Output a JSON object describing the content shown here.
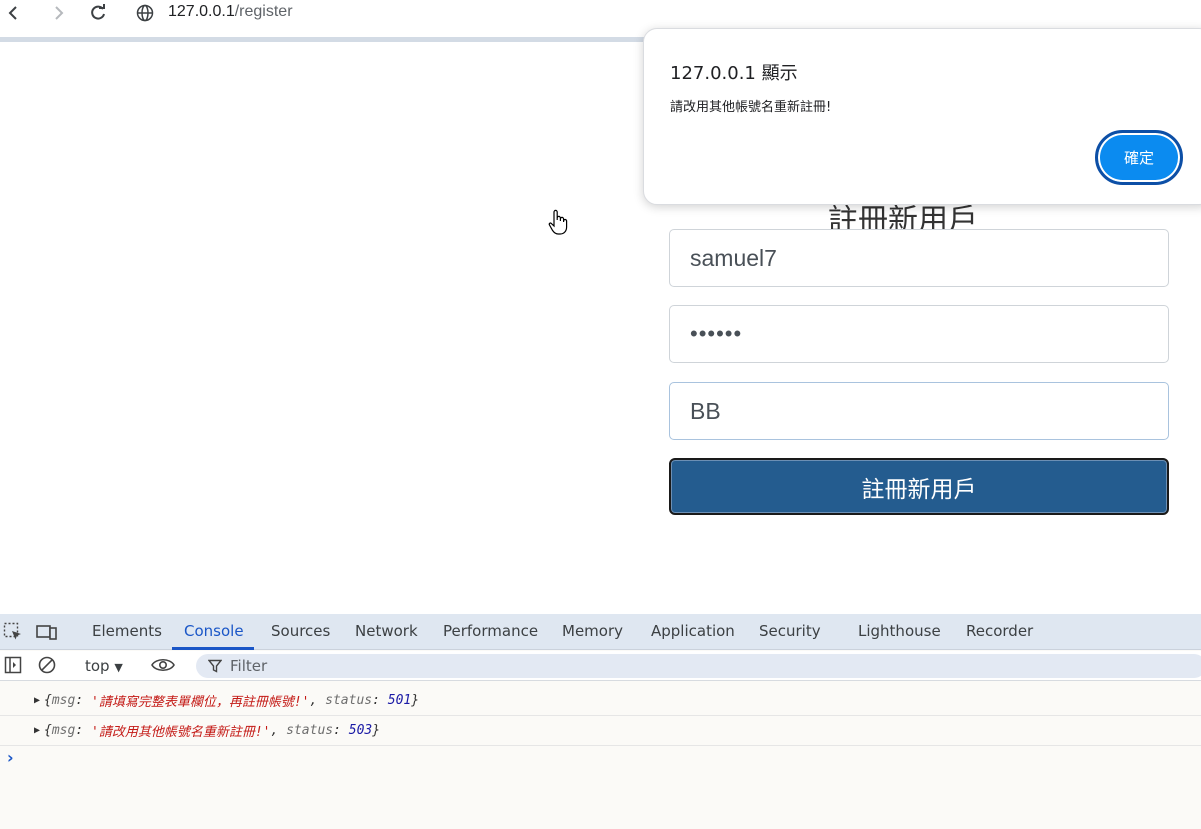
{
  "browser": {
    "url_host": "127.0.0.1",
    "url_path": "/register"
  },
  "form": {
    "title": "註冊新用戶",
    "username_value": "samuel7",
    "password_masked": "••••••",
    "name_value": "BB",
    "submit_label": "註冊新用戶"
  },
  "dialog": {
    "title": "127.0.0.1 顯示",
    "message": "請改用其他帳號名重新註冊!",
    "ok_label": "確定"
  },
  "devtools": {
    "tabs": [
      "Elements",
      "Console",
      "Sources",
      "Network",
      "Performance",
      "Memory",
      "Application",
      "Security",
      "Lighthouse",
      "Recorder"
    ],
    "active_tab": "Console",
    "context": "top",
    "filter_placeholder": "Filter",
    "logs": [
      {
        "open": "{",
        "msg_key": "msg",
        "msg_value": "'請填寫完整表單欄位，再註冊帳號!'",
        "status_key": "status",
        "status_value": "501",
        "close": "}"
      },
      {
        "open": "{",
        "msg_key": "msg",
        "msg_value": "'請改用其他帳號名重新註冊!'",
        "status_key": "status",
        "status_value": "503",
        "close": "}"
      }
    ]
  },
  "colors": {
    "submit_button": "#245c8f",
    "ok_button": "#0b8bf0",
    "active_tab": "#1a56c7"
  }
}
